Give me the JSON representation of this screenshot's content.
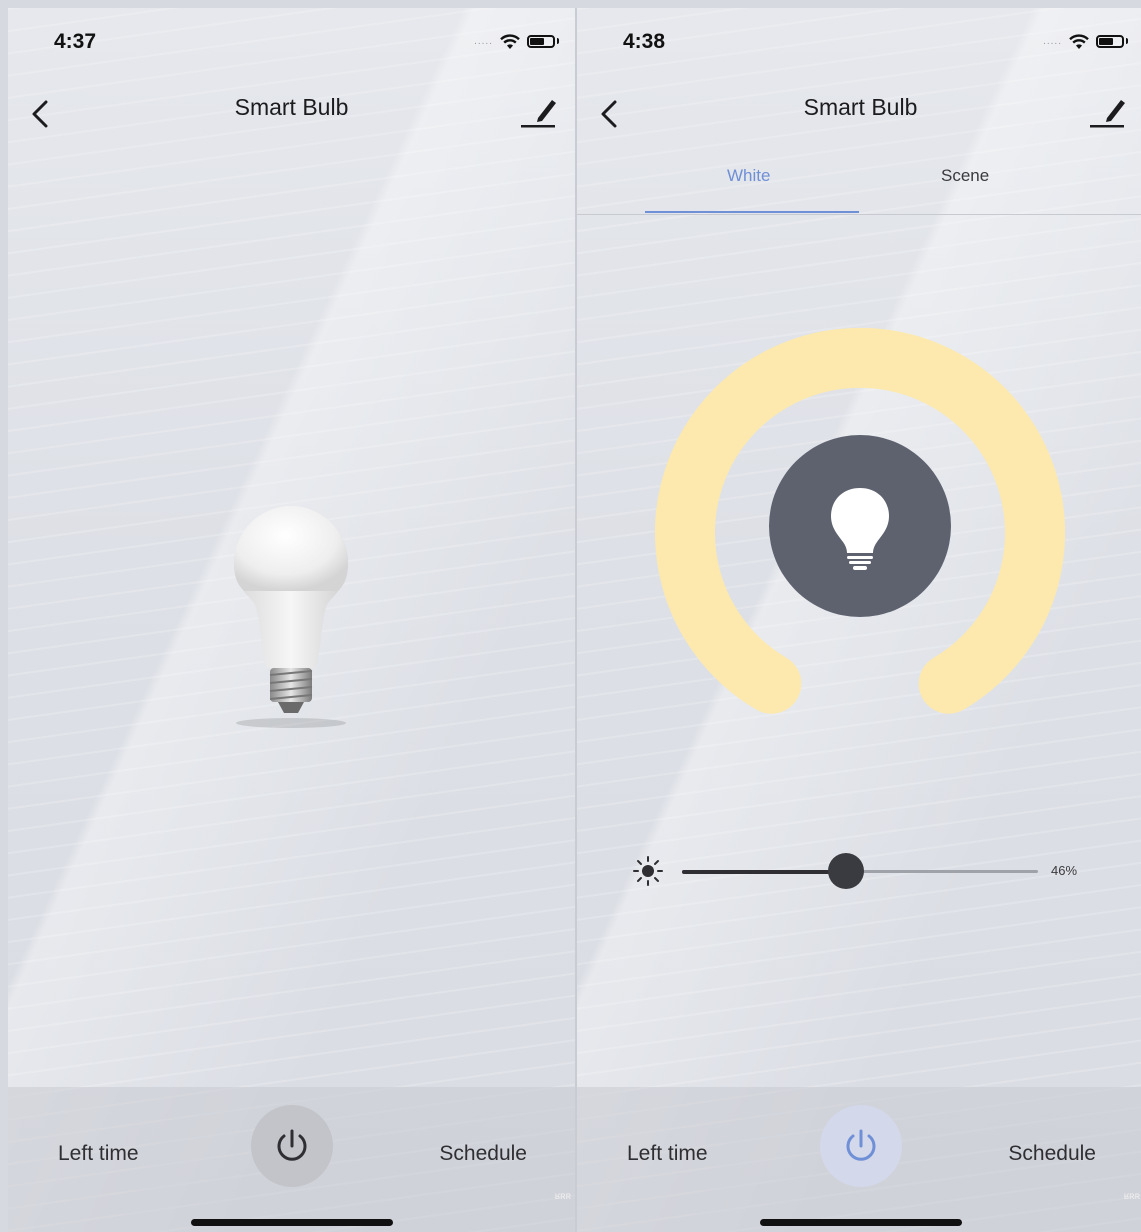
{
  "left": {
    "status": {
      "time": "4:37",
      "signal": "....."
    },
    "title": "Smart Bulb",
    "bottom": {
      "left_label": "Left time",
      "right_label": "Schedule",
      "watermark": "ʁʀʀ"
    }
  },
  "right": {
    "status": {
      "time": "4:38",
      "signal": "....."
    },
    "title": "Smart Bulb",
    "tabs": [
      {
        "label": "White",
        "active": true
      },
      {
        "label": "Scene",
        "active": false
      }
    ],
    "brightness": {
      "value_label": "46%",
      "value": 0.46
    },
    "colors": {
      "ring": "#fde9ad",
      "center_knob": "#5e626f",
      "accent": "#6f8fd6"
    },
    "bottom": {
      "left_label": "Left time",
      "right_label": "Schedule",
      "watermark": "ʁʀʀ"
    }
  }
}
